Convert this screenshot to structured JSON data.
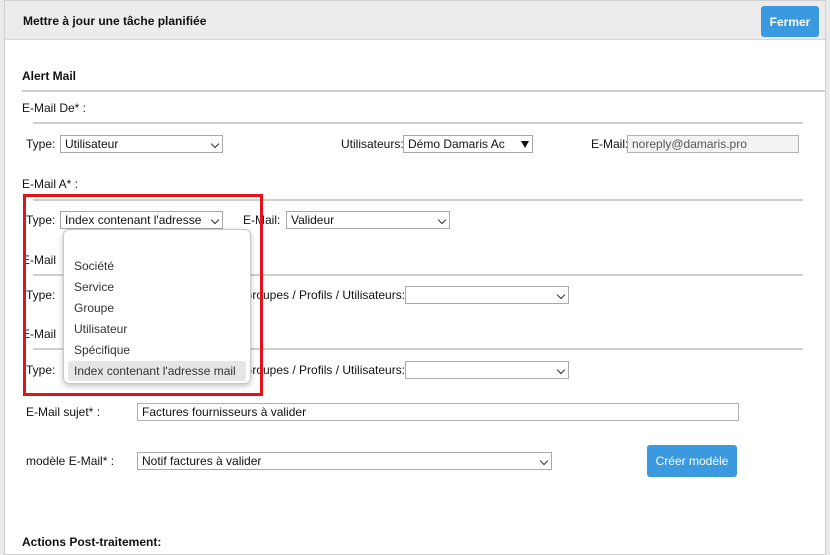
{
  "modal": {
    "title": "Mettre à jour une tâche planifiée",
    "close_label": "Fermer"
  },
  "alert_mail": {
    "section_title": "Alert Mail",
    "from": {
      "label": "E-Mail De* :",
      "type_label": "Type:",
      "type_value": "Utilisateur",
      "users_label": "Utilisateurs:",
      "users_value": "Démo Damaris Ac",
      "email_label": "E-Mail:",
      "email_value": "noreply@damaris.pro"
    },
    "to": {
      "label": "E-Mail A* :",
      "type_label": "Type:",
      "type_value": "Index contenant l'adresse",
      "email_label": "E-Mail:",
      "email_value": "Valideur"
    },
    "cc": {
      "label": "E-Mail",
      "type_label": "Type:",
      "groups_label": "Groupes / Profils / Utilisateurs:",
      "groups_value": ""
    },
    "bcc": {
      "label": "E-Mail",
      "type_label": "Type:",
      "groups_label": "Groupes / Profils / Utilisateurs:",
      "groups_value": ""
    },
    "subject": {
      "label": "E-Mail sujet* :",
      "value": "Factures fournisseurs à valider"
    },
    "template": {
      "label": "modèle E-Mail* :",
      "value": "Notif factures à valider",
      "create_button": "Créer modèle"
    }
  },
  "type_dropdown": {
    "options": [
      "",
      "Société",
      "Service",
      "Groupe",
      "Utilisateur",
      "Spécifique",
      "Index contenant l'adresse mail"
    ],
    "selected": "Index contenant l'adresse mail"
  },
  "post_actions": {
    "section_title": "Actions Post-traitement:"
  },
  "colors": {
    "primary_button": "#3b99e0",
    "highlight": "#e1141e"
  }
}
